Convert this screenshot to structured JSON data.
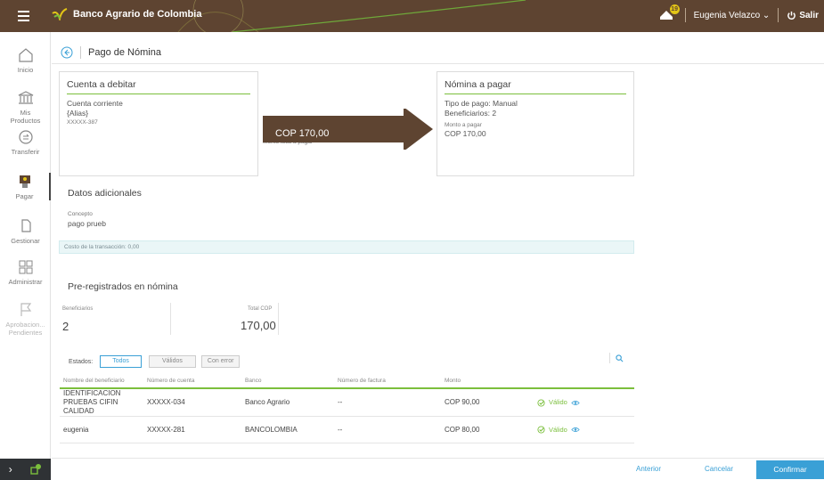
{
  "header": {
    "brand": "Banco Agrario de Colombia",
    "notification_count": "19",
    "user_name": "Eugenia Velazco",
    "logout_label": "Salir"
  },
  "sidebar": {
    "items": [
      {
        "label": "Inicio",
        "icon": "home-icon"
      },
      {
        "label": "Mis Productos",
        "icon": "bank-icon"
      },
      {
        "label": "Transferir",
        "icon": "transfer-icon"
      },
      {
        "label": "Pagar",
        "icon": "pay-icon"
      },
      {
        "label": "Gestionar",
        "icon": "manage-icon"
      },
      {
        "label": "Administrar",
        "icon": "grid-icon"
      },
      {
        "label": "Aprobacion... Pendientes",
        "icon": "flag-icon"
      }
    ]
  },
  "page": {
    "title": "Pago de Nómina"
  },
  "debit_card": {
    "title": "Cuenta a debitar",
    "account_type": "Cuenta corriente",
    "alias": "{Alias}",
    "account_number": "XXXXX-387"
  },
  "transfer": {
    "label": "Monto total a pagar",
    "amount": "COP 170,00"
  },
  "payroll_card": {
    "title": "Nómina a pagar",
    "payment_type": "Tipo de pago: Manual",
    "beneficiaries": "Beneficiarios: 2",
    "amount_label": "Monto a pagar",
    "amount": "COP 170,00"
  },
  "additional": {
    "title": "Datos adicionales",
    "concept_label": "Concepto",
    "concept_value": "pago prueb",
    "cost_text": "Costo de la transacción: 0,00"
  },
  "preregistered": {
    "title": "Pre-registrados en nómina",
    "beneficiaries_label": "Beneficiarios",
    "beneficiaries_value": "2",
    "total_label": "Total COP",
    "total_value": "170,00"
  },
  "filters": {
    "label": "Estados:",
    "options": [
      "Todos",
      "Válidos",
      "Con error"
    ],
    "selected": "Todos"
  },
  "table": {
    "headers": [
      "Nombre del beneficiario",
      "Número de cuenta",
      "Banco",
      "Número de factura",
      "Monto",
      ""
    ],
    "rows": [
      {
        "name_1": "IDENTIFICACION",
        "name_2": "PRUEBAS CIFIN CALIDAD",
        "account": "XXXXX-034",
        "bank": "Banco Agrario",
        "invoice": "--",
        "amount": "COP 90,00",
        "status": "Válido"
      },
      {
        "name_1": "eugenia",
        "name_2": "",
        "account": "XXXXX-281",
        "bank": "BANCOLOMBIA",
        "invoice": "--",
        "amount": "COP 80,00",
        "status": "Válido"
      }
    ]
  },
  "footer": {
    "previous": "Anterior",
    "cancel": "Cancelar",
    "confirm": "Confirmar"
  },
  "colors": {
    "topbar": "#5e4431",
    "accent_green": "#7bbf3c",
    "accent_blue": "#3aa0d6"
  }
}
